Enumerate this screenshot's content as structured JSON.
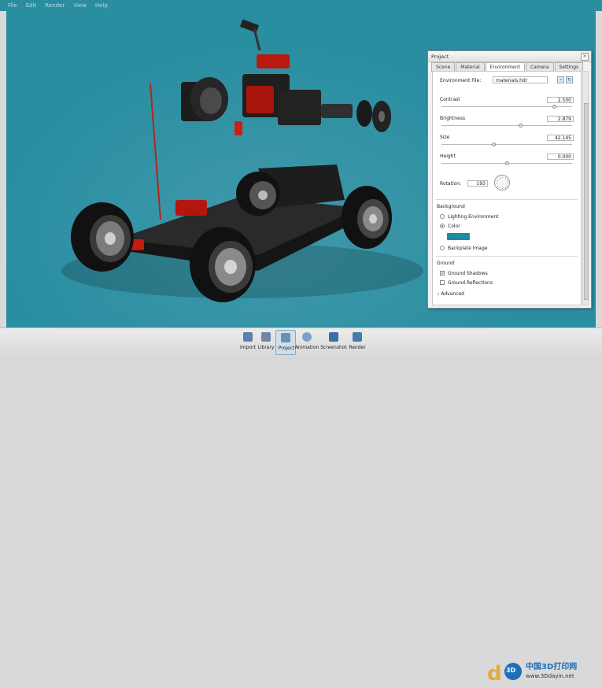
{
  "menu": [
    "File",
    "Edit",
    "Render",
    "View",
    "Help"
  ],
  "panel": {
    "title": "Project",
    "close": "×",
    "tabs": [
      "Scene",
      "Material",
      "Environment",
      "Camera",
      "Settings"
    ],
    "active_tab": "Environment",
    "environment_file": {
      "label": "Environment File:",
      "value": "materials.hdr"
    },
    "sliders": [
      {
        "label": "Contrast",
        "value": "2.500",
        "level": 0.86
      },
      {
        "label": "Brightness",
        "value": "2.879",
        "level": 0.6
      },
      {
        "label": "Size",
        "value": "42.145",
        "level": 0.4
      },
      {
        "label": "Height",
        "value": "0.000",
        "level": 0.5
      }
    ],
    "rotation": {
      "label": "Rotation:",
      "value": "193"
    },
    "background": {
      "heading": "Background",
      "options": [
        "Lighting Environment",
        "Color",
        "Backplate Image"
      ],
      "selected": "Color",
      "color": "#1f8aa0"
    },
    "ground": {
      "heading": "Ground",
      "options": [
        {
          "label": "Ground Shadows",
          "checked": true
        },
        {
          "label": "Ground Reflections",
          "checked": false
        }
      ]
    },
    "advanced": "Advanced",
    "advanced_marker": "›"
  },
  "toolbar": [
    {
      "label": "Import",
      "icon": "import-icon"
    },
    {
      "label": "Library",
      "icon": "library-icon"
    },
    {
      "label": "Project",
      "icon": "project-icon",
      "active": true
    },
    {
      "label": "Animation",
      "icon": "animation-icon"
    },
    {
      "label": "Screenshot",
      "icon": "screenshot-icon"
    },
    {
      "label": "Render",
      "icon": "render-icon"
    }
  ],
  "watermark": {
    "text": "中国3D打印网",
    "url": "www.3Ddayin.net",
    "badge": "3D"
  },
  "colors": {
    "viewport_bg": "#2a8ea1",
    "accent": "#1f8aa0"
  }
}
